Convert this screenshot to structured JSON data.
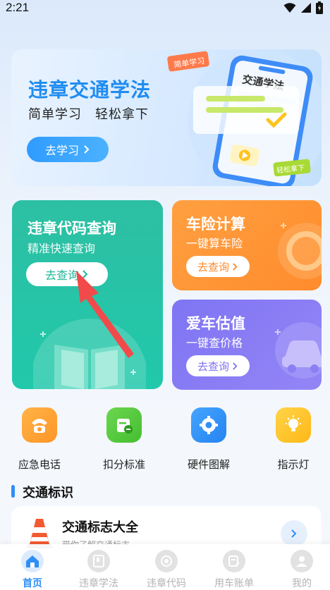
{
  "status_bar": {
    "time": "2:21"
  },
  "banner": {
    "title": "违章交通学法",
    "subtitle": "简单学习　轻松拿下",
    "button_label": "去学习",
    "tag_top": "简单学习",
    "phone_title": "交通学法",
    "tag_bottom": "轻松拿下"
  },
  "cards": {
    "code_query": {
      "title": "违章代码查询",
      "subtitle": "精准快速查询",
      "button_label": "去查询"
    },
    "insurance": {
      "title": "车险计算",
      "subtitle": "一键算车险",
      "button_label": "去查询"
    },
    "valuation": {
      "title": "爱车估值",
      "subtitle": "一键查价格",
      "button_label": "去查询"
    }
  },
  "quick_actions": [
    {
      "label": "应急电话",
      "icon": "phone-icon",
      "color": "#ff9b2e"
    },
    {
      "label": "扣分标准",
      "icon": "calendar-minus-icon",
      "color": "#53c93c"
    },
    {
      "label": "硬件图解",
      "icon": "gear-icon",
      "color": "#2f8ff5"
    },
    {
      "label": "指示灯",
      "icon": "bulb-icon",
      "color": "#ffc21f"
    }
  ],
  "section": {
    "title": "交通标识",
    "item_title": "交通标志大全",
    "item_subtitle": "带你了解交通标志"
  },
  "tab_bar": {
    "items": [
      {
        "label": "首页",
        "icon": "home-icon",
        "active": true
      },
      {
        "label": "违章学法",
        "icon": "book-icon",
        "active": false
      },
      {
        "label": "违章代码",
        "icon": "disc-icon",
        "active": false
      },
      {
        "label": "用车账单",
        "icon": "bill-icon",
        "active": false
      },
      {
        "label": "我的",
        "icon": "user-icon",
        "active": false
      }
    ]
  },
  "colors": {
    "accent": "#2f8ff5",
    "green_card": "#21c8ab",
    "orange_card": "#ff8b2c",
    "purple_card": "#8a7ef5",
    "annotation_arrow": "#f24a4a"
  }
}
